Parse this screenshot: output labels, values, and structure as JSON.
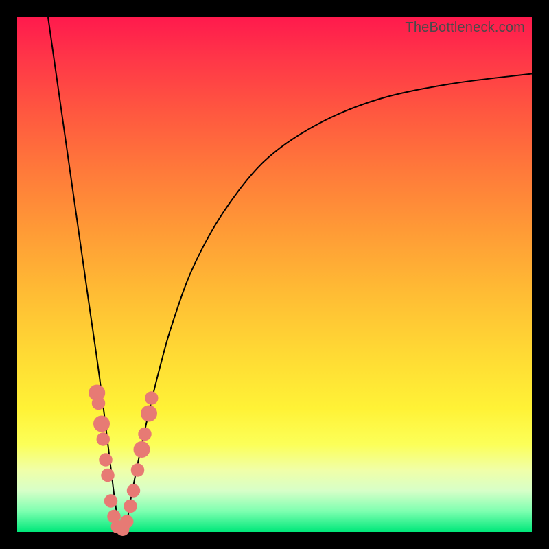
{
  "watermark": "TheBottleneck.com",
  "chart_data": {
    "type": "line",
    "title": "",
    "xlabel": "",
    "ylabel": "",
    "xlim": [
      0,
      100
    ],
    "ylim": [
      0,
      100
    ],
    "description": "V-shaped bottleneck curve on red-to-green gradient. Minimum bottleneck near x≈20 at y≈0; rises steeply toward 100 on both sides.",
    "series": [
      {
        "name": "bottleneck-curve",
        "x": [
          6,
          8,
          10,
          12,
          14,
          16,
          18,
          19,
          20,
          21,
          22,
          24,
          26,
          28,
          30,
          34,
          40,
          48,
          58,
          70,
          84,
          100
        ],
        "y": [
          100,
          86,
          72,
          58,
          44,
          30,
          14,
          6,
          0,
          0,
          6,
          16,
          25,
          33,
          40,
          51,
          62,
          72,
          79,
          84,
          87,
          89
        ]
      }
    ],
    "markers": [
      {
        "x": 15.5,
        "y": 27,
        "r": 1.6
      },
      {
        "x": 15.8,
        "y": 25,
        "r": 1.3
      },
      {
        "x": 16.4,
        "y": 21,
        "r": 1.6
      },
      {
        "x": 16.7,
        "y": 18,
        "r": 1.3
      },
      {
        "x": 17.2,
        "y": 14,
        "r": 1.3
      },
      {
        "x": 17.6,
        "y": 11,
        "r": 1.3
      },
      {
        "x": 18.2,
        "y": 6,
        "r": 1.3
      },
      {
        "x": 18.8,
        "y": 3,
        "r": 1.3
      },
      {
        "x": 19.5,
        "y": 1,
        "r": 1.3
      },
      {
        "x": 20.5,
        "y": 0.5,
        "r": 1.3
      },
      {
        "x": 21.3,
        "y": 2,
        "r": 1.3
      },
      {
        "x": 22.0,
        "y": 5,
        "r": 1.3
      },
      {
        "x": 22.6,
        "y": 8,
        "r": 1.3
      },
      {
        "x": 23.4,
        "y": 12,
        "r": 1.3
      },
      {
        "x": 24.2,
        "y": 16,
        "r": 1.6
      },
      {
        "x": 24.8,
        "y": 19,
        "r": 1.3
      },
      {
        "x": 25.6,
        "y": 23,
        "r": 1.6
      },
      {
        "x": 26.1,
        "y": 26,
        "r": 1.3
      }
    ]
  }
}
